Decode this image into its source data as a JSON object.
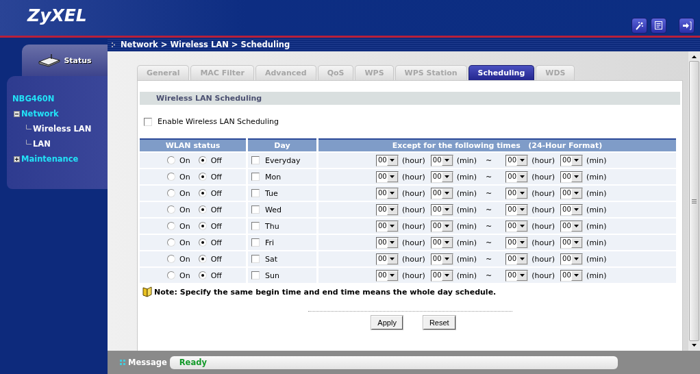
{
  "header": {
    "logo": "ZyXEL"
  },
  "sidebar": {
    "status_tab": "Status",
    "tree": [
      {
        "label": "NBG460N",
        "children": [
          {
            "label": "Network",
            "expanded": true,
            "children": [
              {
                "label": "Wireless LAN"
              },
              {
                "label": "LAN"
              }
            ]
          },
          {
            "label": "Maintenance",
            "expanded": false
          }
        ]
      }
    ]
  },
  "breadcrumb": "Network > Wireless LAN > Scheduling",
  "tabs": [
    {
      "label": "General",
      "selected": false
    },
    {
      "label": "MAC Filter",
      "selected": false
    },
    {
      "label": "Advanced",
      "selected": false
    },
    {
      "label": "QoS",
      "selected": false
    },
    {
      "label": "WPS",
      "selected": false
    },
    {
      "label": "WPS Station",
      "selected": false
    },
    {
      "label": "Scheduling",
      "selected": true
    },
    {
      "label": "WDS",
      "selected": false
    }
  ],
  "section_title": "Wireless LAN Scheduling",
  "enable": {
    "label": "Enable Wireless LAN Scheduling",
    "checked": false
  },
  "table": {
    "columns": [
      "WLAN status",
      "Day",
      "Except for the following times   (24-Hour Format)"
    ],
    "separator": "~",
    "rows": [
      {
        "status": [
          {
            "label": "On",
            "selected": false
          },
          {
            "label": "Off",
            "selected": true
          }
        ],
        "day": "Everyday",
        "checked": false,
        "times": [
          {
            "value": "00",
            "unit": "(hour)"
          },
          {
            "value": "00",
            "unit": "(min)"
          },
          {
            "value": "00",
            "unit": "(hour)"
          },
          {
            "value": "00",
            "unit": "(min)"
          }
        ]
      },
      {
        "status": [
          {
            "label": "On",
            "selected": false
          },
          {
            "label": "Off",
            "selected": true
          }
        ],
        "day": "Mon",
        "checked": false,
        "times": [
          {
            "value": "00",
            "unit": "(hour)"
          },
          {
            "value": "00",
            "unit": "(min)"
          },
          {
            "value": "00",
            "unit": "(hour)"
          },
          {
            "value": "00",
            "unit": "(min)"
          }
        ]
      },
      {
        "status": [
          {
            "label": "On",
            "selected": false
          },
          {
            "label": "Off",
            "selected": true
          }
        ],
        "day": "Tue",
        "checked": false,
        "times": [
          {
            "value": "00",
            "unit": "(hour)"
          },
          {
            "value": "00",
            "unit": "(min)"
          },
          {
            "value": "00",
            "unit": "(hour)"
          },
          {
            "value": "00",
            "unit": "(min)"
          }
        ]
      },
      {
        "status": [
          {
            "label": "On",
            "selected": false
          },
          {
            "label": "Off",
            "selected": true
          }
        ],
        "day": "Wed",
        "checked": false,
        "times": [
          {
            "value": "00",
            "unit": "(hour)"
          },
          {
            "value": "00",
            "unit": "(min)"
          },
          {
            "value": "00",
            "unit": "(hour)"
          },
          {
            "value": "00",
            "unit": "(min)"
          }
        ]
      },
      {
        "status": [
          {
            "label": "On",
            "selected": false
          },
          {
            "label": "Off",
            "selected": true
          }
        ],
        "day": "Thu",
        "checked": false,
        "times": [
          {
            "value": "00",
            "unit": "(hour)"
          },
          {
            "value": "00",
            "unit": "(min)"
          },
          {
            "value": "00",
            "unit": "(hour)"
          },
          {
            "value": "00",
            "unit": "(min)"
          }
        ]
      },
      {
        "status": [
          {
            "label": "On",
            "selected": false
          },
          {
            "label": "Off",
            "selected": true
          }
        ],
        "day": "Fri",
        "checked": false,
        "times": [
          {
            "value": "00",
            "unit": "(hour)"
          },
          {
            "value": "00",
            "unit": "(min)"
          },
          {
            "value": "00",
            "unit": "(hour)"
          },
          {
            "value": "00",
            "unit": "(min)"
          }
        ]
      },
      {
        "status": [
          {
            "label": "On",
            "selected": false
          },
          {
            "label": "Off",
            "selected": true
          }
        ],
        "day": "Sat",
        "checked": false,
        "times": [
          {
            "value": "00",
            "unit": "(hour)"
          },
          {
            "value": "00",
            "unit": "(min)"
          },
          {
            "value": "00",
            "unit": "(hour)"
          },
          {
            "value": "00",
            "unit": "(min)"
          }
        ]
      },
      {
        "status": [
          {
            "label": "On",
            "selected": false
          },
          {
            "label": "Off",
            "selected": true
          }
        ],
        "day": "Sun",
        "checked": false,
        "times": [
          {
            "value": "00",
            "unit": "(hour)"
          },
          {
            "value": "00",
            "unit": "(min)"
          },
          {
            "value": "00",
            "unit": "(hour)"
          },
          {
            "value": "00",
            "unit": "(min)"
          }
        ]
      }
    ]
  },
  "note": "Note: Specify the same begin time and end time means the whole day schedule.",
  "buttons": [
    "Apply",
    "Reset"
  ],
  "message": {
    "label": "Message",
    "value": "Ready"
  }
}
